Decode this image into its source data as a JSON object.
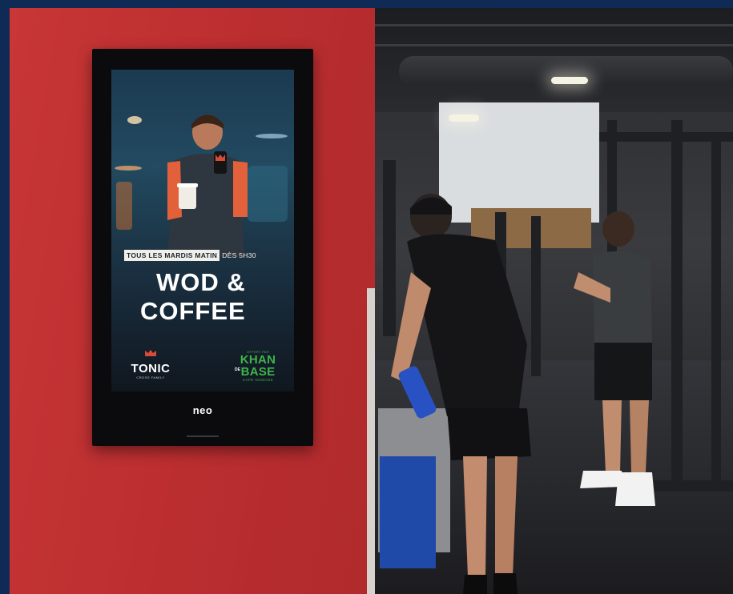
{
  "photo": {
    "subject": "",
    "wall_color": "#bd2f31",
    "frame_color": "#0f2a55"
  },
  "display": {
    "tagline_highlight": "TOUS LES MARDIS MATIN",
    "tagline_time": "DÈS 5H30",
    "headline_line1": "WOD &",
    "headline_line2": "COFFEE",
    "left_brand": {
      "name": "TONIC",
      "subtitle": "CROSS FAMILY"
    },
    "right_brand": {
      "offered_by": "OFFERT PAR",
      "name_line1": "KHAN",
      "name_line2": "BASE",
      "name_mid": "DE",
      "subtitle": "CAFÉ NOMADE"
    },
    "accent_green": "#3fb34a"
  },
  "screen_brand": "neo"
}
